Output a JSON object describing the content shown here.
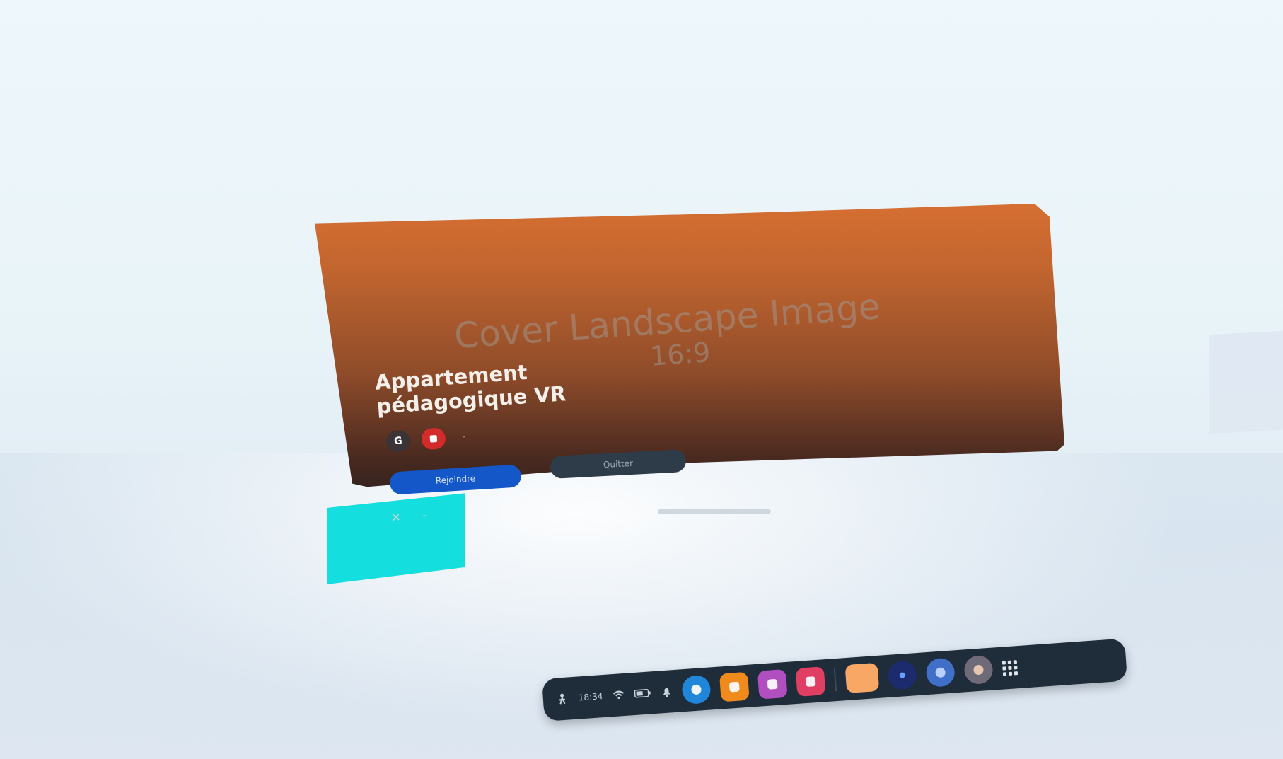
{
  "card": {
    "cover_text": "Cover Landscape Image",
    "cover_ratio": "16:9",
    "title": "Appartement pédagogique VR",
    "badges": [
      "G",
      "",
      "-"
    ],
    "primary_button": "Rejoindre",
    "secondary_button": "Quitter",
    "close_glyph": "×",
    "minimize_glyph": "–"
  },
  "taskbar": {
    "time": "18:34",
    "wifi_icon": "wifi-icon",
    "battery_icon": "battery-icon",
    "apps": [
      {
        "name": "notifications",
        "color": "#1f2c3a"
      },
      {
        "name": "info-app",
        "color": "#1f86d9"
      },
      {
        "name": "folder-app",
        "color": "#f08a1c"
      },
      {
        "name": "people-app",
        "color": "#b24fc0"
      },
      {
        "name": "camera-app",
        "color": "#e03e62"
      },
      {
        "name": "peach-app",
        "color": "#f8a765"
      },
      {
        "name": "dark-app",
        "color": "#1c2a6e"
      },
      {
        "name": "blue-app",
        "color": "#3f6fc7"
      },
      {
        "name": "avatar-app",
        "color": "#6e6a78"
      }
    ]
  },
  "colors": {
    "card_top": "#d66f32",
    "card_bottom": "#1b1b22",
    "primary_button": "#1357c9",
    "teal_panel": "#14dede"
  }
}
